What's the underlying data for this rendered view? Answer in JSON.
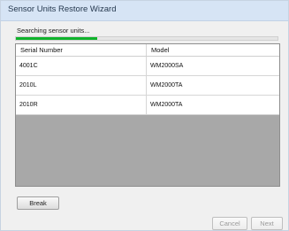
{
  "window": {
    "title": "Sensor Units Restore Wizard"
  },
  "status": {
    "text": "Searching sensor units...",
    "progress": 0.31,
    "progress_color": "#0fb32b"
  },
  "table": {
    "columns": [
      "Serial Number",
      "Model"
    ],
    "rows": [
      {
        "serial": "4001C",
        "model": "WM2000SA"
      },
      {
        "serial": "2010L",
        "model": "WM2000TA"
      },
      {
        "serial": "2010R",
        "model": "WM2000TA"
      }
    ]
  },
  "buttons": {
    "break_label": "Break",
    "cancel_label": "Cancel",
    "next_label": "Next"
  }
}
